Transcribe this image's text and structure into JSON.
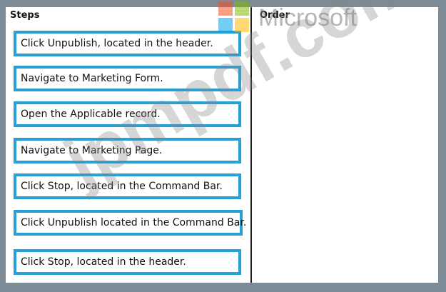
{
  "headers": {
    "steps": "Steps",
    "order": "Order"
  },
  "steps": [
    "Click Unpublish, located in the header.",
    "Navigate to Marketing Form.",
    "Open the Applicable record.",
    "Navigate to Marketing Page.",
    "Click Stop, located in the Command Bar.",
    "Click Unpublish located in the Command Bar.",
    "Click Stop, located in the header."
  ],
  "logo": {
    "word": "Microsoft",
    "colors": [
      "#f25022",
      "#7fba00",
      "#00a4ef",
      "#ffb900"
    ]
  },
  "watermark": "jpmpdf.com"
}
